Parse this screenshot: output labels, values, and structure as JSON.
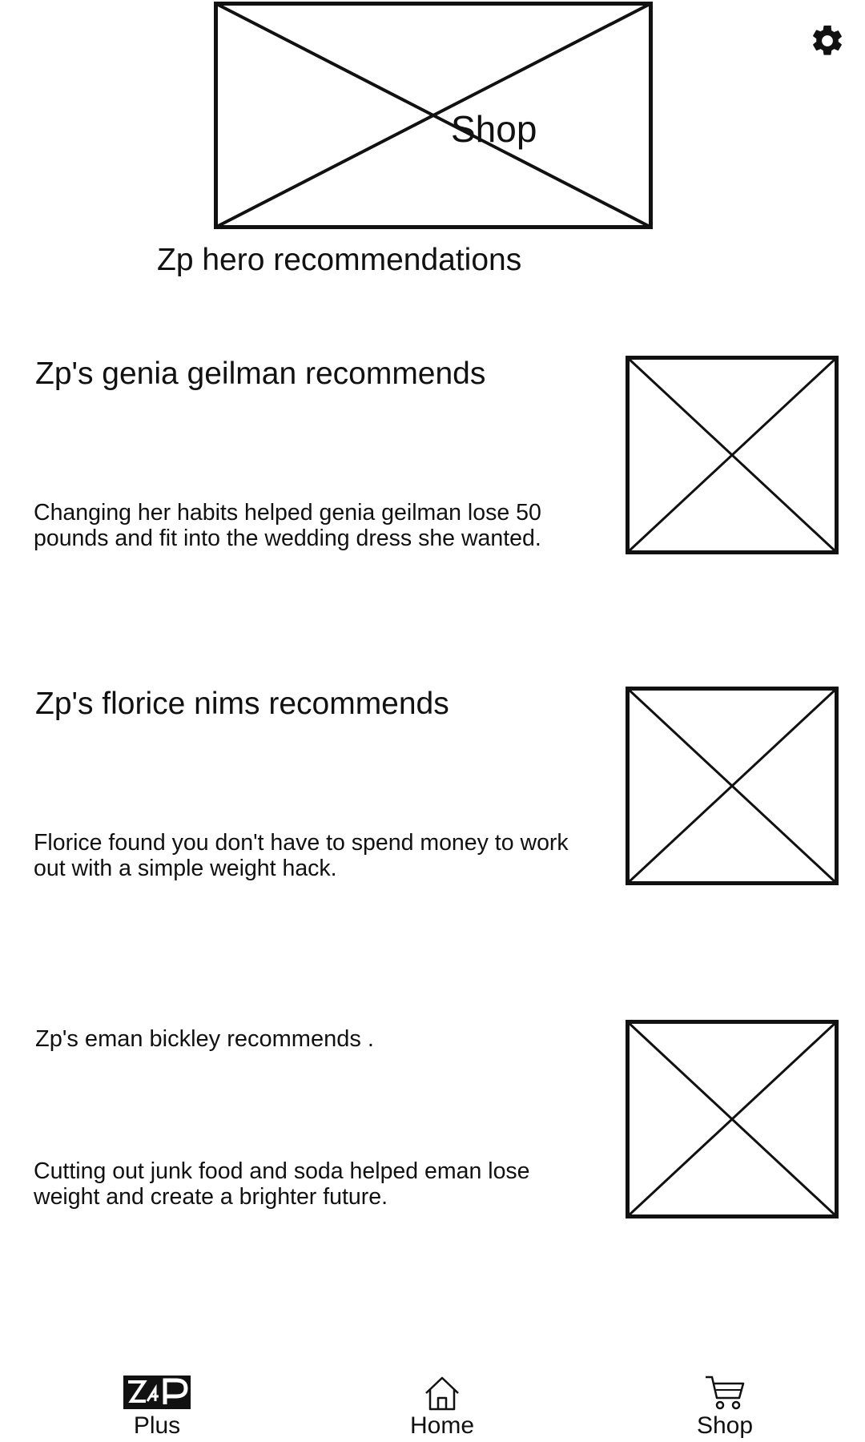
{
  "hero": {
    "label": "Shop"
  },
  "section_title": "Zp hero recommendations",
  "cards": [
    {
      "title": "Zp's genia geilman recommends",
      "description": "Changing her habits helped genia geilman lose 50 pounds and fit into the wedding dress she wanted."
    },
    {
      "title": "Zp's florice nims recommends",
      "description": "Florice found you don't have to spend money to work out with a simple weight hack."
    },
    {
      "title": "Zp's eman bickley recommends .",
      "description": "Cutting out junk food and soda helped eman lose weight and create a brighter future."
    }
  ],
  "nav": {
    "items": [
      {
        "label": "Plus",
        "icon": "zp-logo-icon"
      },
      {
        "label": "Home",
        "icon": "home-icon"
      },
      {
        "label": "Shop",
        "icon": "cart-icon"
      }
    ],
    "logo_text": "ZP"
  },
  "colors": {
    "stroke": "#111111",
    "background": "#ffffff"
  }
}
